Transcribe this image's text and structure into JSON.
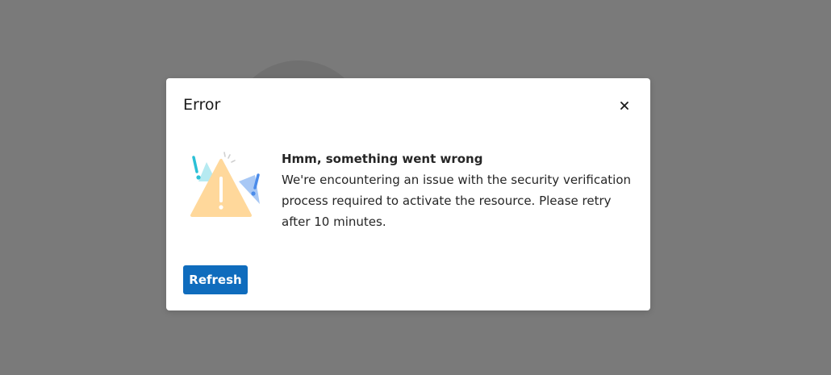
{
  "dialog": {
    "title": "Error",
    "close_icon": "close-icon",
    "heading": "Hmm, something went wrong",
    "body": "We're encountering an issue with the security verification process required to activate the resource. Please retry after 10 minutes.",
    "refresh_label": "Refresh",
    "illustration_icon": "warning-triangle-icon"
  },
  "colors": {
    "overlay": "#7a7a7a",
    "primary_button": "#0f6cbd",
    "warning_yellow": "#ffd89b",
    "accent_teal": "#2bc0d6",
    "accent_blue": "#4a8bea"
  }
}
